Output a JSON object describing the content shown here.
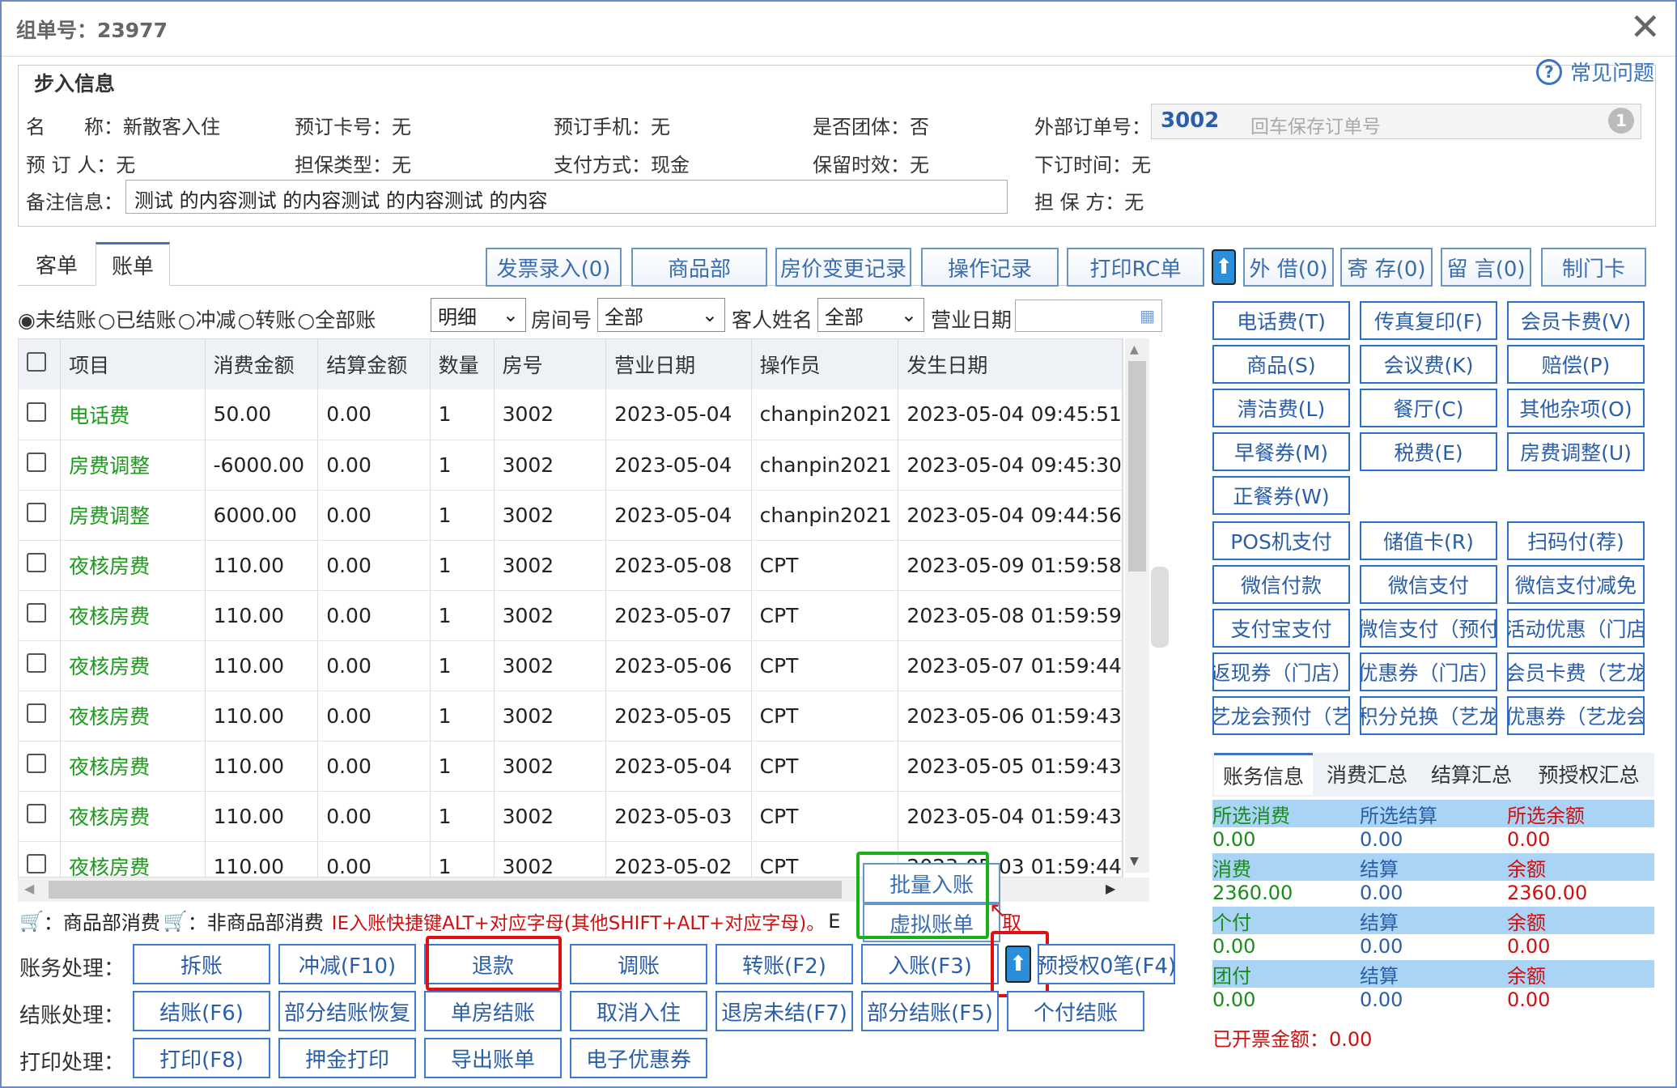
{
  "window": {
    "title": "组单号：23977",
    "close": "✕"
  },
  "info": {
    "legend": "步入信息",
    "faq": "常见问题",
    "name_label": "名　　称：",
    "name": "新散客入住",
    "card_label": "预订卡号：",
    "card": "无",
    "phone_label": "预订手机：",
    "phone": "无",
    "group_label": "是否团体：",
    "group": "否",
    "ext_label": "外部订单号：",
    "ext_value": "3002",
    "ext_placeholder": "回车保存订单号",
    "ext_clear": "1",
    "booker_label": "预 订 人：",
    "booker": "无",
    "guarantee_type_label": "担保类型：",
    "guarantee_type": "无",
    "pay_label": "支付方式：",
    "pay": "现金",
    "keep_label": "保留时效：",
    "keep": "无",
    "order_time_label": "下订时间：",
    "order_time": "无",
    "remark_label": "备注信息：",
    "remark": "测试 的内容测试 的内容测试 的内容测试 的内容",
    "guarantor_label": "担 保 方：",
    "guarantor": "无"
  },
  "tabs": [
    "客单",
    "账单"
  ],
  "toolbar": [
    "发票录入(0)",
    "商品部",
    "房价变更记录",
    "操作记录",
    "打印RC单",
    "外 借(0)",
    "寄 存(0)",
    "留 言(0)",
    "制门卡"
  ],
  "filters": {
    "radios": [
      "未结账",
      "已结账",
      "冲减",
      "转账",
      "全部账"
    ],
    "detail": "明细",
    "room_label": "房间号",
    "room": "全部",
    "guest_label": "客人姓名",
    "guest": "全部",
    "date_label": "营业日期"
  },
  "table": {
    "headers": [
      "项目",
      "消费金额",
      "结算金额",
      "数量",
      "房号",
      "营业日期",
      "操作员",
      "发生日期"
    ],
    "rows": [
      [
        "电话费",
        "50.00",
        "0.00",
        "1",
        "3002",
        "2023-05-04",
        "chanpin2021",
        "2023-05-04 09:45:51"
      ],
      [
        "房费调整",
        "-6000.00",
        "0.00",
        "1",
        "3002",
        "2023-05-04",
        "chanpin2021",
        "2023-05-04 09:45:30"
      ],
      [
        "房费调整",
        "6000.00",
        "0.00",
        "1",
        "3002",
        "2023-05-04",
        "chanpin2021",
        "2023-05-04 09:44:56"
      ],
      [
        "夜核房费",
        "110.00",
        "0.00",
        "1",
        "3002",
        "2023-05-08",
        "CPT",
        "2023-05-09 01:59:58"
      ],
      [
        "夜核房费",
        "110.00",
        "0.00",
        "1",
        "3002",
        "2023-05-07",
        "CPT",
        "2023-05-08 01:59:59"
      ],
      [
        "夜核房费",
        "110.00",
        "0.00",
        "1",
        "3002",
        "2023-05-06",
        "CPT",
        "2023-05-07 01:59:44"
      ],
      [
        "夜核房费",
        "110.00",
        "0.00",
        "1",
        "3002",
        "2023-05-05",
        "CPT",
        "2023-05-06 01:59:43"
      ],
      [
        "夜核房费",
        "110.00",
        "0.00",
        "1",
        "3002",
        "2023-05-04",
        "CPT",
        "2023-05-05 01:59:43"
      ],
      [
        "夜核房费",
        "110.00",
        "0.00",
        "1",
        "3002",
        "2023-05-03",
        "CPT",
        "2023-05-04 01:59:43"
      ],
      [
        "夜核房费",
        "110.00",
        "0.00",
        "1",
        "3002",
        "2023-05-02",
        "CPT",
        "2023-05-03 01:59:44"
      ]
    ]
  },
  "right_buttons": [
    [
      "电话费(T)",
      "传真复印(F)",
      "会员卡费(V)"
    ],
    [
      "商品(S)",
      "会议费(K)",
      "赔偿(P)"
    ],
    [
      "清洁费(L)",
      "餐厅(C)",
      "其他杂项(O)"
    ],
    [
      "早餐券(M)",
      "税费(E)",
      "房费调整(U)"
    ],
    [
      "正餐券(W)"
    ]
  ],
  "pay_buttons": [
    [
      "POS机支付",
      "储值卡(R)",
      "扫码付(荐)"
    ],
    [
      "微信付款",
      "微信支付",
      "微信支付减免"
    ],
    [
      "支付宝支付",
      "微信支付（预付",
      "活动优惠（门店"
    ],
    [
      "返现券（门店）",
      "优惠券（门店）",
      "会员卡费（艺龙"
    ],
    [
      "艺龙会预付（艺",
      "积分兑换（艺龙",
      "优惠券（艺龙会"
    ]
  ],
  "summary": {
    "tabs": [
      "账务信息",
      "消费汇总",
      "结算汇总",
      "预授权汇总"
    ],
    "rows": [
      {
        "labels": [
          "所选消费",
          "所选结算",
          "所选余额"
        ],
        "values": [
          "0.00",
          "0.00",
          "0.00"
        ]
      },
      {
        "labels": [
          "消费",
          "结算",
          "余额"
        ],
        "values": [
          "2360.00",
          "0.00",
          "2360.00"
        ]
      },
      {
        "labels": [
          "个付",
          "结算",
          "余额"
        ],
        "values": [
          "0.00",
          "0.00",
          "0.00"
        ]
      },
      {
        "labels": [
          "团付",
          "结算",
          "余额"
        ],
        "values": [
          "0.00",
          "0.00",
          "0.00"
        ]
      }
    ],
    "invoice": "已开票金额：0.00"
  },
  "legend_line": {
    "a": "：商品部消费",
    "b": "：非商品部消费",
    "hint": "IE入账快捷键ALT+对应字母(其他SHIFT+ALT+对应字母)。",
    "cut1": "E",
    "cut2": "取"
  },
  "popup": {
    "batch": "批量入账",
    "virtual": "虚拟账单"
  },
  "actions": {
    "acct_label": "账务处理：",
    "acct": [
      "拆账",
      "冲减(F10)",
      "退款",
      "调账",
      "转账(F2)",
      "入账(F3)"
    ],
    "preauth": "预授权0笔(F4)",
    "settle_label": "结账处理：",
    "settle": [
      "结账(F6)",
      "部分结账恢复",
      "单房结账",
      "取消入住",
      "退房未结(F7)",
      "部分结账(F5)",
      "个付结账"
    ],
    "print_label": "打印处理：",
    "print": [
      "打印(F8)",
      "押金打印",
      "导出账单",
      "电子优惠券"
    ]
  }
}
